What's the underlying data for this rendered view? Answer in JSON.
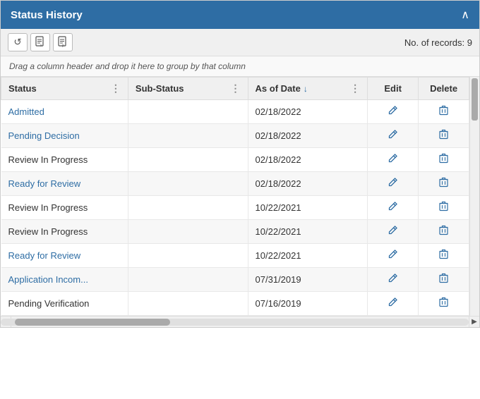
{
  "header": {
    "title": "Status History",
    "chevron": "^"
  },
  "toolbar": {
    "undo_icon": "↺",
    "export_csv_icon": "📄",
    "export_pdf_icon": "📋",
    "records_label": "No. of records:",
    "records_count": "9"
  },
  "drag_hint": "Drag a column header and drop it here to group by that column",
  "columns": [
    {
      "label": "Status",
      "menu": "⋮",
      "sort": ""
    },
    {
      "label": "Sub-Status",
      "menu": "⋮",
      "sort": ""
    },
    {
      "label": "As of Date",
      "menu": "⋮",
      "sort": "↓"
    },
    {
      "label": "Edit",
      "menu": "",
      "sort": ""
    },
    {
      "label": "Delete",
      "menu": "",
      "sort": ""
    }
  ],
  "rows": [
    {
      "status": "Admitted",
      "sub_status": "",
      "as_of_date": "02/18/2022",
      "is_link": true
    },
    {
      "status": "Pending Decision",
      "sub_status": "",
      "as_of_date": "02/18/2022",
      "is_link": true
    },
    {
      "status": "Review In Progress",
      "sub_status": "",
      "as_of_date": "02/18/2022",
      "is_link": false
    },
    {
      "status": "Ready for Review",
      "sub_status": "",
      "as_of_date": "02/18/2022",
      "is_link": true
    },
    {
      "status": "Review In Progress",
      "sub_status": "",
      "as_of_date": "10/22/2021",
      "is_link": false
    },
    {
      "status": "Review In Progress",
      "sub_status": "",
      "as_of_date": "10/22/2021",
      "is_link": false
    },
    {
      "status": "Ready for Review",
      "sub_status": "",
      "as_of_date": "10/22/2021",
      "is_link": true
    },
    {
      "status": "Application Incom...",
      "sub_status": "",
      "as_of_date": "07/31/2019",
      "is_link": true
    },
    {
      "status": "Pending Verification",
      "sub_status": "",
      "as_of_date": "07/16/2019",
      "is_link": false
    }
  ],
  "icons": {
    "edit": "✎",
    "delete": "🗑",
    "chevron_up": "^",
    "scroll_right": "▶",
    "scroll_left": "◀"
  }
}
